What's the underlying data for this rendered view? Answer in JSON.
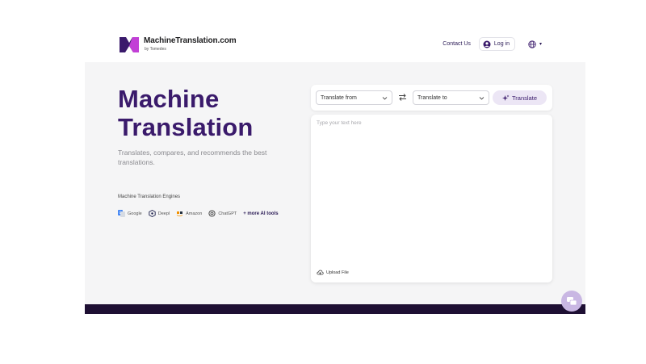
{
  "header": {
    "logo_name": "MachineTranslation.com",
    "logo_by": "by Tomedes",
    "contact_label": "Contact Us",
    "login_label": "Log in",
    "lang_icon": "globe-icon"
  },
  "hero": {
    "title_line1": "Machine",
    "title_line2": "Translation",
    "subtitle": "Translates, compares, and recommends the best translations.",
    "engines_label": "Machine Translation Engines",
    "engines": [
      {
        "name": "Google",
        "icon": "google-translate-icon"
      },
      {
        "name": "Deepl",
        "icon": "deepl-icon"
      },
      {
        "name": "Amazon",
        "icon": "amazon-icon"
      },
      {
        "name": "ChatGPT",
        "icon": "chatgpt-icon"
      }
    ],
    "more_tools": "+ more AI tools"
  },
  "translator": {
    "from_label": "Translate from",
    "to_label": "Translate to",
    "translate_button": "Translate",
    "placeholder": "Type your text here",
    "upload_label": "Upload File"
  },
  "colors": {
    "brand_purple": "#3a1a6b",
    "button_bg": "#ece6f5",
    "hero_bg": "#f5f5f6",
    "footer": "#1e0f33",
    "chat_fab": "#c9b7e3"
  }
}
